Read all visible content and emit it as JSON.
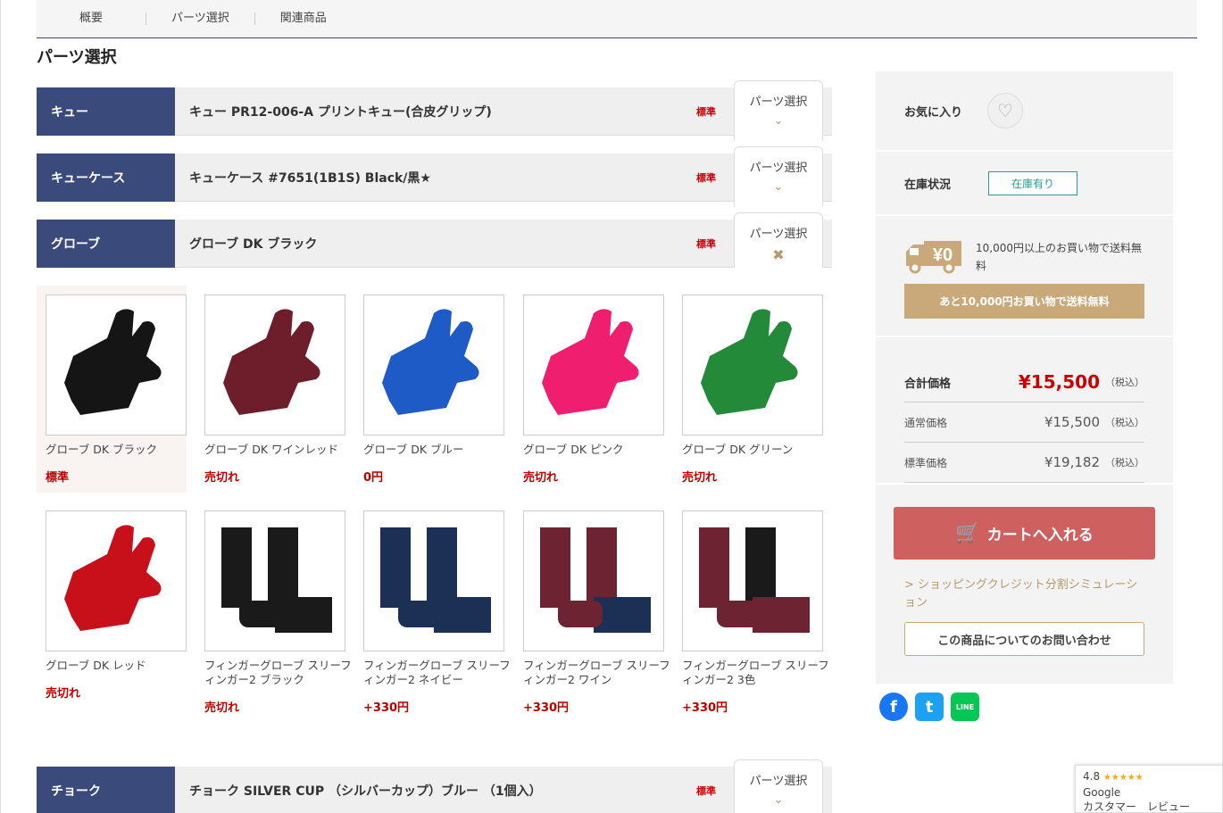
{
  "tabs": [
    "概要",
    "パーツ選択",
    "関連商品"
  ],
  "section_title": "パーツ選択",
  "parts": [
    {
      "label": "キュー",
      "name": "キュー PR12-006-A プリントキュー(合皮グリップ)",
      "std": "標準",
      "button": "パーツ選択",
      "icon": "chevron-down-icon"
    },
    {
      "label": "キューケース",
      "name": "キューケース #7651(1B1S) Black/黒★",
      "std": "標準",
      "button": "パーツ選択",
      "icon": "chevron-down-icon"
    },
    {
      "label": "グローブ",
      "name": "グローブ DK ブラック",
      "std": "標準",
      "button": "パーツ選択",
      "icon": "close-icon"
    },
    {
      "label": "チョーク",
      "name": "チョーク SILVER CUP （シルバーカップ）ブルー （1個入）",
      "std": "標準",
      "button": "パーツ選択",
      "icon": "chevron-down-icon"
    }
  ],
  "gloves": [
    {
      "name": "グローブ DK ブラック",
      "price": "標準",
      "color": "#151515",
      "type": "glove",
      "selected": true
    },
    {
      "name": "グローブ DK ワインレッド",
      "price": "売切れ",
      "color": "#6e1e2a",
      "type": "glove"
    },
    {
      "name": "グローブ DK ブルー",
      "price": "0円",
      "color": "#1e5bc6",
      "type": "glove"
    },
    {
      "name": "グローブ DK ピンク",
      "price": "売切れ",
      "color": "#f01e6e",
      "type": "glove"
    },
    {
      "name": "グローブ DK グリーン",
      "price": "売切れ",
      "color": "#238a3a",
      "type": "glove"
    },
    {
      "name": "グローブ DK レッド",
      "price": "売切れ",
      "color": "#c8101a",
      "type": "glove"
    },
    {
      "name": "フィンガーグローブ スリーフィンガー2 ブラック",
      "price": "売切れ",
      "color": "#1a1a1a",
      "type": "finger"
    },
    {
      "name": "フィンガーグローブ スリーフィンガー2 ネイビー",
      "price": "+330円",
      "color": "#1c2f55",
      "type": "finger"
    },
    {
      "name": "フィンガーグローブ スリーフィンガー2 ワイン",
      "price": "+330円",
      "color": "#6e2333",
      "type": "finger"
    },
    {
      "name": "フィンガーグローブ スリーフィンガー2 3色",
      "price": "+330円",
      "color": "#6e2333",
      "type": "finger3"
    }
  ],
  "sidebar": {
    "favorite_label": "お気に入り",
    "stock_label": "在庫状況",
    "stock_badge": "在庫有り",
    "truck_text": "¥0",
    "shipping_text": "10,000円以上のお買い物で送料無料",
    "shipping_button": "あと10,000円お買い物で送料無料",
    "total_label": "合計価格",
    "total_value": "¥15,500",
    "regular_label": "通常価格",
    "regular_value": "¥15,500",
    "standard_label": "標準価格",
    "standard_value": "¥19,182",
    "tax": "（税込）",
    "cart_button": "カートへ入れる",
    "credit_link": "> ショッピングクレジット分割シミュレーション",
    "inquiry_button": "この商品についてのお問い合わせ"
  },
  "social": {
    "facebook": "f",
    "twitter": "t",
    "line": "LINE"
  },
  "google_badge": {
    "rating": "4.8",
    "stars": "★★★★★",
    "line1": "Google",
    "line2": "カスタマー　レビュー"
  }
}
